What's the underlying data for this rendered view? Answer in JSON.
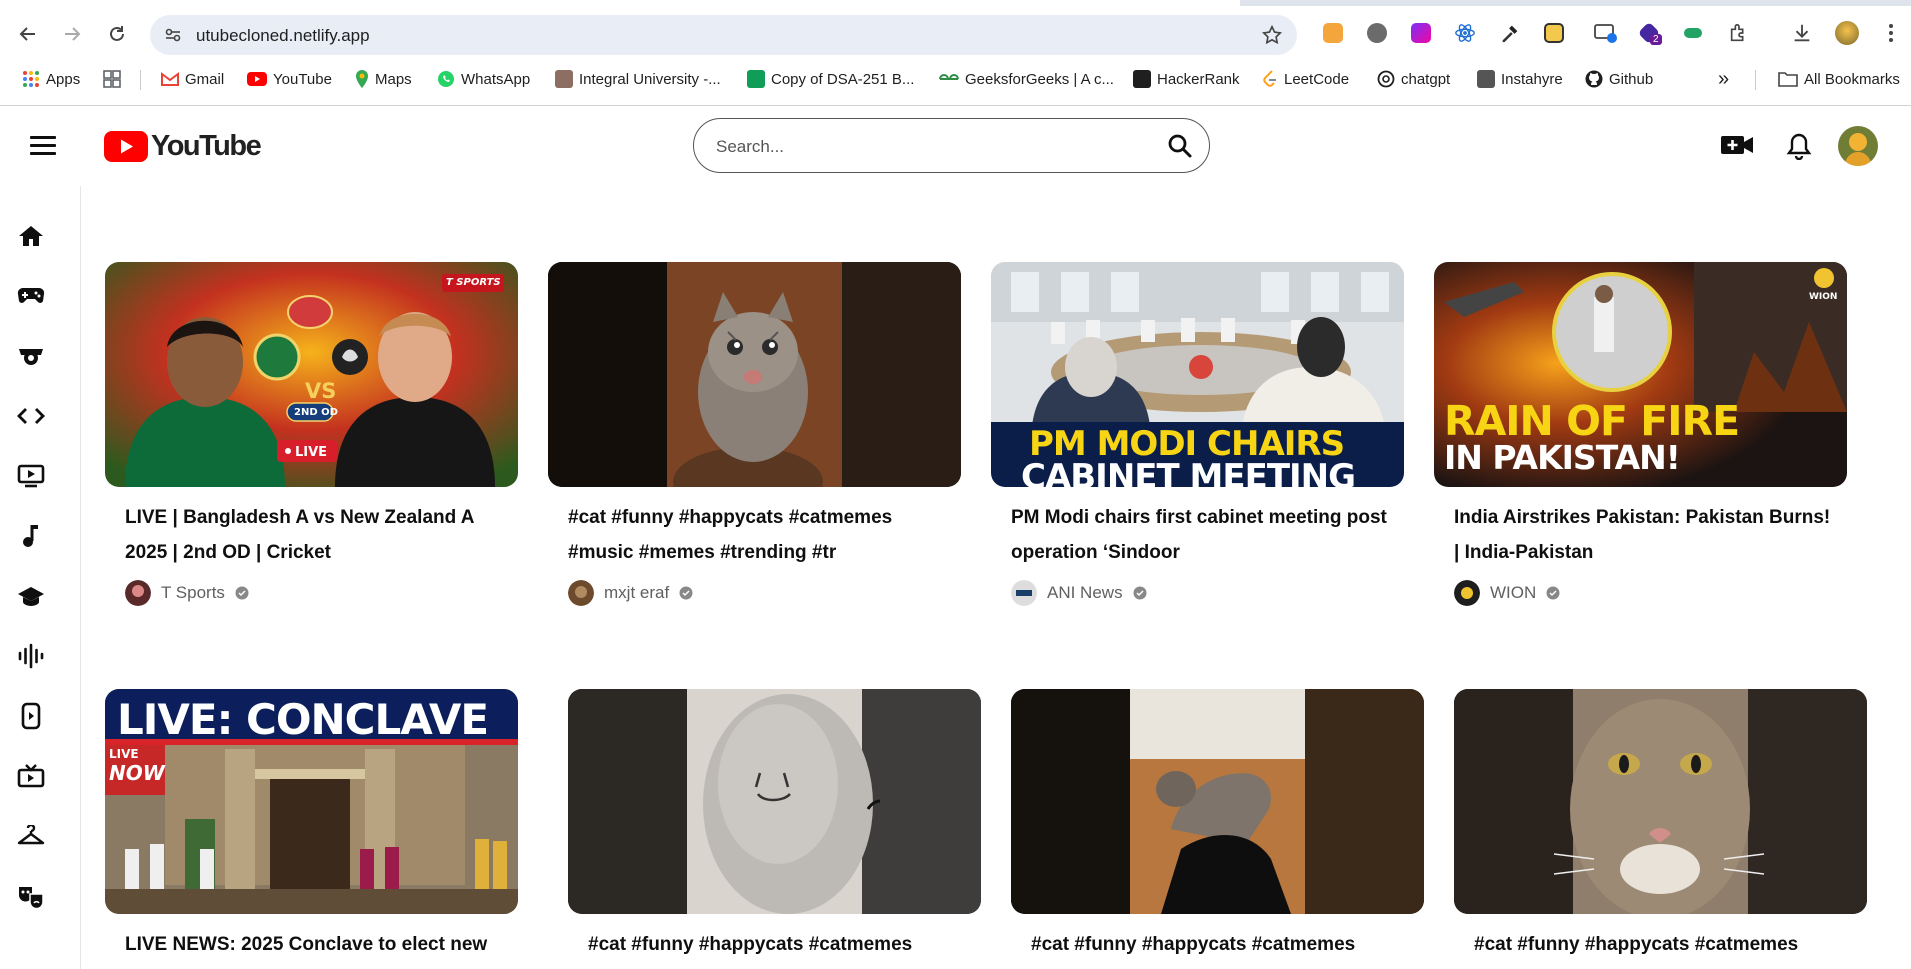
{
  "browser": {
    "url": "utubecloned.netlify.app",
    "bookmarks": [
      {
        "label": "Apps",
        "color": "#ea4335"
      },
      {
        "label": "",
        "color": "#5f6368"
      },
      {
        "label": "Gmail",
        "color": "#ea4335"
      },
      {
        "label": "YouTube",
        "color": "#ff0000"
      },
      {
        "label": "Maps",
        "color": "#34a853"
      },
      {
        "label": "WhatsApp",
        "color": "#25d366"
      },
      {
        "label": "Integral University -...",
        "color": "#8d6e63"
      },
      {
        "label": "Copy of DSA-251 B...",
        "color": "#0f9d58"
      },
      {
        "label": "GeeksforGeeks | A c...",
        "color": "#2f8d46"
      },
      {
        "label": "HackerRank",
        "color": "#1f1f1f"
      },
      {
        "label": "LeetCode",
        "color": "#ffa116"
      },
      {
        "label": "chatgpt",
        "color": "#1f1f1f"
      },
      {
        "label": "Instahyre",
        "color": "#555555"
      },
      {
        "label": "Github",
        "color": "#1f1f1f"
      }
    ],
    "more_label": "»",
    "all_bookmarks": "All Bookmarks",
    "extension_badge": "2"
  },
  "header": {
    "logo_text": "YouTube",
    "search_placeholder": "Search..."
  },
  "sidebar": {
    "icons": [
      "home-icon",
      "games-icon",
      "anime-icon",
      "code-icon",
      "live-icon",
      "music-icon",
      "education-icon",
      "podcast-icon",
      "shorts-icon",
      "tv-icon",
      "fashion-icon",
      "drama-icon"
    ]
  },
  "videos": [
    {
      "title": "LIVE | Bangladesh A vs New Zealand A 2025 | 2nd OD | Cricket",
      "channel": "T Sports",
      "thumb_text": "LIVE",
      "thumb_brand": "T SPORTS",
      "thumb_badge": "2ND OD",
      "thumb_vs": "VS"
    },
    {
      "title": "#cat #funny #happycats #catmemes #music #memes #trending #tr",
      "channel": "mxjt eraf"
    },
    {
      "title": "PM Modi chairs first cabinet meeting post operation ‘Sindoor",
      "channel": "ANI News",
      "thumb_line1": "PM MODI CHAIRS",
      "thumb_line2": "CABINET MEETING"
    },
    {
      "title": "India Airstrikes Pakistan: Pakistan Burns! | India-Pakistan",
      "channel": "WION",
      "thumb_line1": "RAIN OF FIRE",
      "thumb_line2": "IN PAKISTAN!",
      "thumb_brand": "WION"
    },
    {
      "title": "LIVE NEWS: 2025 Conclave to elect new",
      "thumb_line1": "LIVE: CONCLAVE",
      "thumb_brand": "LIVE",
      "thumb_now": "NOW"
    },
    {
      "title": "#cat #funny #happycats #catmemes"
    },
    {
      "title": "#cat #funny #happycats #catmemes"
    },
    {
      "title": "#cat #funny #happycats #catmemes"
    }
  ]
}
